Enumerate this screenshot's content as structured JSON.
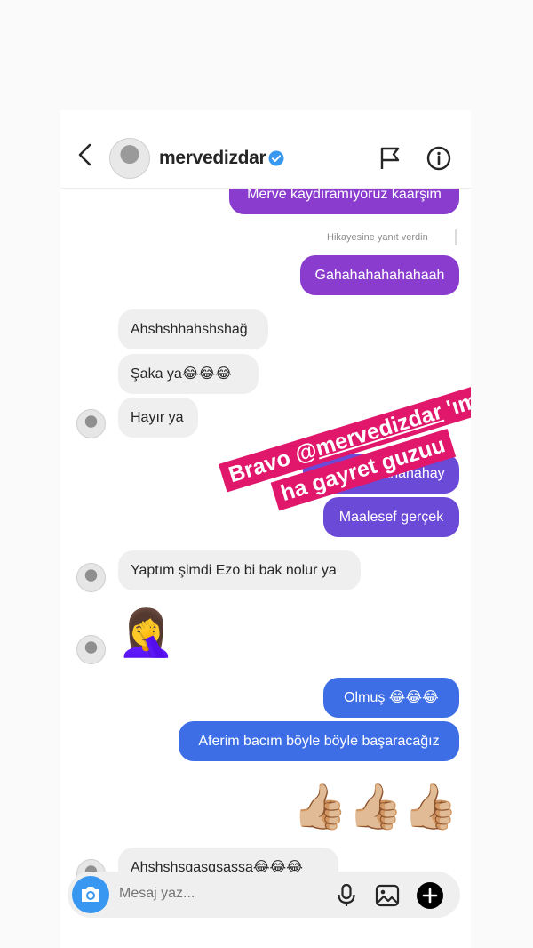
{
  "header": {
    "username": "mervedizdar"
  },
  "thread": {
    "reply_note": "Hikayesine yanıt verdin",
    "messages": [
      {
        "text": "Merve kaydıramıyoruz kaarşim",
        "from": "me"
      },
      {
        "text": "Gahahahahahahaah",
        "from": "me"
      },
      {
        "text": "Ahshshhahshshağ",
        "from": "them"
      },
      {
        "text": "Şaka ya😂😂😂",
        "from": "them"
      },
      {
        "text": "Hayır ya",
        "from": "them"
      },
      {
        "text": "Agahahahahahahay",
        "from": "me"
      },
      {
        "text": "Maalesef gerçek",
        "from": "me"
      },
      {
        "text": "Yaptım şimdi Ezo bi bak nolur ya",
        "from": "them"
      },
      {
        "text": "🤦‍♀️",
        "from": "them"
      },
      {
        "text": "Olmuş 😂😂😂",
        "from": "me"
      },
      {
        "text": "Aferim bacım böyle böyle başaracağız",
        "from": "me"
      },
      {
        "text": "👍🏼👍🏼👍🏼",
        "from": "me"
      },
      {
        "text": "Ahshshsgasgsassa😂😂😂",
        "from": "them"
      }
    ]
  },
  "sticker": {
    "line1_prefix": "Bravo @",
    "line1_mention": "mervedizdar",
    "line1_suffix": " 'ım",
    "line2": "ha gayret guzuu"
  },
  "composer": {
    "placeholder": "Mesaj yaz..."
  },
  "colors": {
    "purple": "#8a3ccf",
    "violet": "#6b4ad8",
    "blue": "#3e6ee6",
    "sticker": "#e0176b",
    "verified": "#3897f0"
  }
}
